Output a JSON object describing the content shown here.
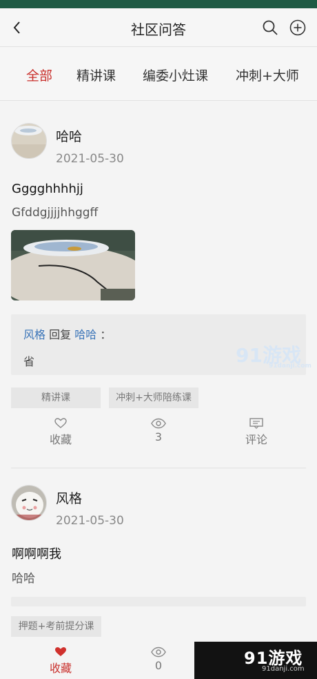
{
  "header": {
    "title": "社区问答"
  },
  "tabs": [
    {
      "label": "全部",
      "active": true
    },
    {
      "label": "精讲课",
      "active": false
    },
    {
      "label": "编委小灶课",
      "active": false
    },
    {
      "label": "冲刺+大师",
      "active": false
    }
  ],
  "posts": [
    {
      "author": "哈哈",
      "date": "2021-05-30",
      "title": "Gggghhhhjj",
      "body": "Gfddgjjjjhhggff",
      "reply": {
        "from": "风格",
        "verb": "回复",
        "to": "哈哈",
        "colon": "：",
        "text": "省"
      },
      "tags": [
        "精讲课",
        "冲刺+大师陪练课"
      ],
      "actions": {
        "favorite": "收藏",
        "views": "3",
        "comment": "评论"
      }
    },
    {
      "author": "风格",
      "date": "2021-05-30",
      "title": "啊啊啊我",
      "body": "哈哈",
      "tags": [
        "押题+考前提分课"
      ],
      "actions": {
        "favorite": "收藏",
        "views": "0"
      }
    }
  ],
  "watermark": {
    "logo": "91游戏",
    "site": "91danji.com"
  },
  "colors": {
    "accent": "#c9302c",
    "link": "#3a74b8",
    "statusbar": "#1f5a44"
  }
}
